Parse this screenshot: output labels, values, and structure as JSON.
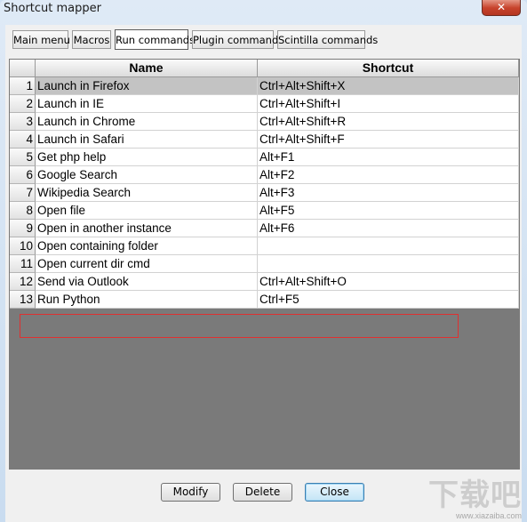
{
  "window": {
    "title": "Shortcut mapper",
    "close_glyph": "✕"
  },
  "tabs": [
    {
      "label": "Main menu"
    },
    {
      "label": "Macros"
    },
    {
      "label": "Run commands",
      "active": true
    },
    {
      "label": "Plugin commands"
    },
    {
      "label": "Scintilla commands"
    }
  ],
  "table": {
    "headers": {
      "name": "Name",
      "shortcut": "Shortcut"
    },
    "rows": [
      {
        "num": "1",
        "name": "Launch in Firefox",
        "shortcut": "Ctrl+Alt+Shift+X"
      },
      {
        "num": "2",
        "name": "Launch in IE",
        "shortcut": "Ctrl+Alt+Shift+I"
      },
      {
        "num": "3",
        "name": "Launch in Chrome",
        "shortcut": "Ctrl+Alt+Shift+R"
      },
      {
        "num": "4",
        "name": "Launch in Safari",
        "shortcut": "Ctrl+Alt+Shift+F"
      },
      {
        "num": "5",
        "name": "Get php help",
        "shortcut": "Alt+F1"
      },
      {
        "num": "6",
        "name": "Google Search",
        "shortcut": "Alt+F2"
      },
      {
        "num": "7",
        "name": "Wikipedia Search",
        "shortcut": "Alt+F3"
      },
      {
        "num": "8",
        "name": "Open file",
        "shortcut": "Alt+F5"
      },
      {
        "num": "9",
        "name": "Open in another instance",
        "shortcut": "Alt+F6"
      },
      {
        "num": "10",
        "name": "Open containing folder",
        "shortcut": ""
      },
      {
        "num": "11",
        "name": "Open current dir cmd",
        "shortcut": ""
      },
      {
        "num": "12",
        "name": "Send via Outlook",
        "shortcut": "Ctrl+Alt+Shift+O"
      },
      {
        "num": "13",
        "name": "Run Python",
        "shortcut": "Ctrl+F5"
      }
    ],
    "selected_row": "1"
  },
  "buttons": {
    "modify": "Modify",
    "delete": "Delete",
    "close": "Close"
  },
  "watermark": {
    "logo": "下载吧",
    "url": "www.xiazaiba.com"
  }
}
